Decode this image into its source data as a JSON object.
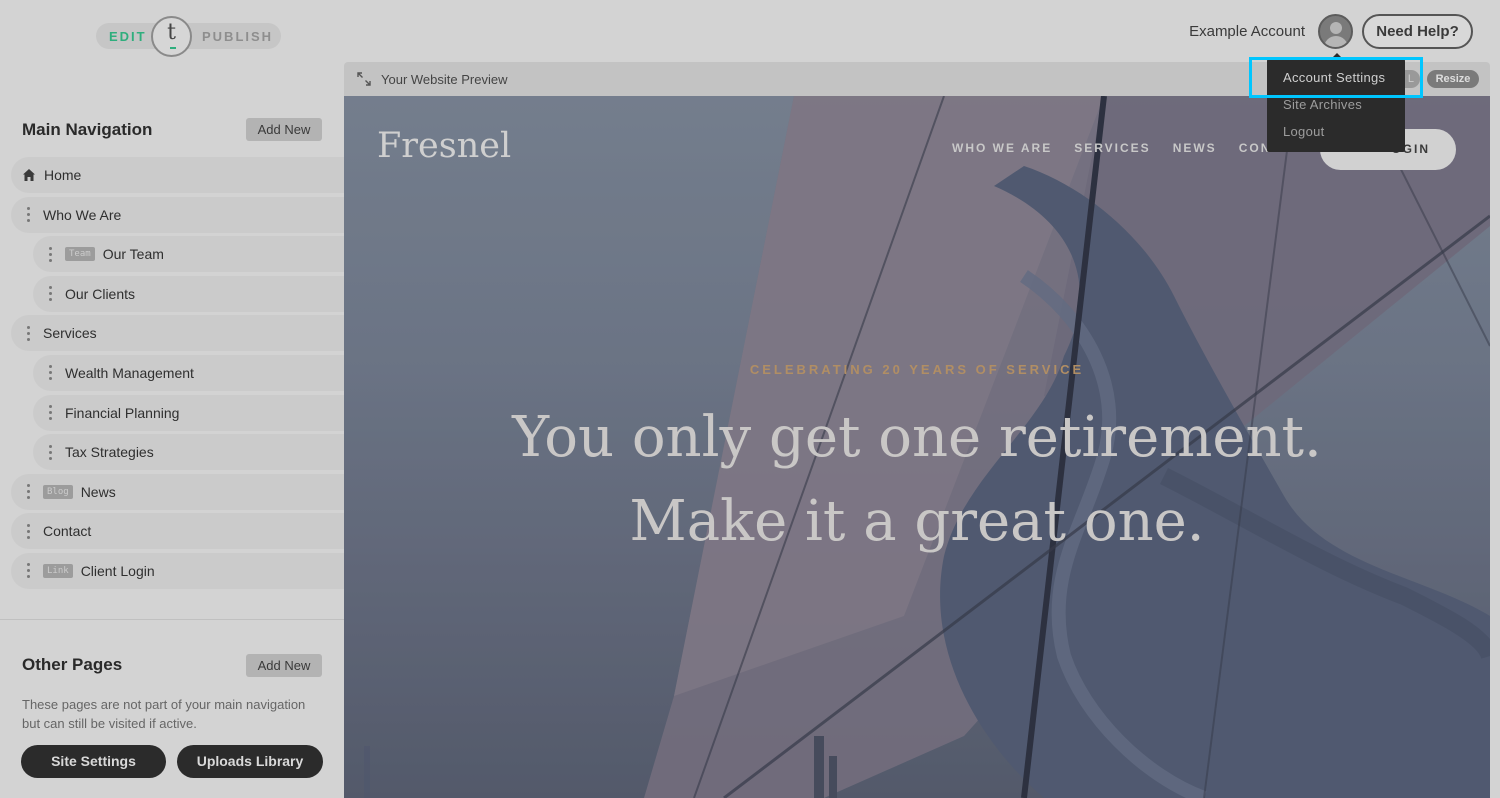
{
  "topbar": {
    "mode_edit": "EDIT",
    "mode_publish": "PUBLISH",
    "logo_letter": "t",
    "account_name": "Example Account",
    "help_label": "Need Help?"
  },
  "account_menu": {
    "items": [
      {
        "label": "Account Settings"
      },
      {
        "label": "Site Archives"
      },
      {
        "label": "Logout"
      }
    ]
  },
  "sidebar": {
    "main_nav_title": "Main Navigation",
    "add_new_label": "Add New",
    "items": [
      {
        "label": "Home",
        "level": 0,
        "icon": "home-icon"
      },
      {
        "label": "Who We Are",
        "level": 0
      },
      {
        "label": "Our Team",
        "level": 1,
        "tag": "Team"
      },
      {
        "label": "Our Clients",
        "level": 1
      },
      {
        "label": "Services",
        "level": 0
      },
      {
        "label": "Wealth Management",
        "level": 1
      },
      {
        "label": "Financial Planning",
        "level": 1
      },
      {
        "label": "Tax Strategies",
        "level": 1
      },
      {
        "label": "News",
        "level": 0,
        "tag": "Blog"
      },
      {
        "label": "Contact",
        "level": 0
      },
      {
        "label": "Client Login",
        "level": 0,
        "tag": "Link"
      }
    ],
    "other_pages_title": "Other Pages",
    "other_add_new_label": "Add New",
    "other_pages_desc": "These pages are not part of your main navigation but can still be visited if active.",
    "site_settings_label": "Site Settings",
    "uploads_library_label": "Uploads Library"
  },
  "preview": {
    "bar_title": "Your Website Preview",
    "url_label": "L",
    "resize_label": "Resize",
    "site": {
      "logo": "Fresnel",
      "nav": [
        "WHO WE ARE",
        "SERVICES",
        "NEWS",
        "CONT"
      ],
      "login_label": "OGIN",
      "tagline": "CELEBRATING 20 YEARS OF SERVICE",
      "headline_1": "You only get one retirement.",
      "headline_2": "Make it a great one."
    }
  },
  "colors": {
    "edit_green": "#2fae7d",
    "highlight": "#00c6ff",
    "tagline_gold": "#b18e64"
  }
}
